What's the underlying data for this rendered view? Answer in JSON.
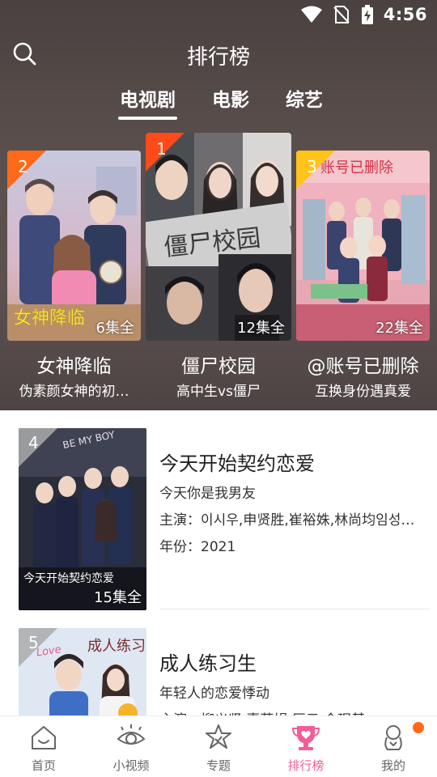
{
  "status": {
    "time": "4:56"
  },
  "header": {
    "title": "排行榜"
  },
  "tabs": [
    {
      "label": "电视剧",
      "active": true
    },
    {
      "label": "电影",
      "active": false
    },
    {
      "label": "综艺",
      "active": false
    }
  ],
  "podium": [
    {
      "rank": "2",
      "title": "女神降临",
      "subtitle": "伪素颜女神的初…",
      "episodes": "6集全",
      "poster_text": "女神降临",
      "rank_color": "#ff6a1a"
    },
    {
      "rank": "1",
      "title": "僵尸校园",
      "subtitle": "高中生vs僵尸",
      "episodes": "12集全",
      "poster_text": "僵尸校园",
      "rank_color": "#ff4a1a"
    },
    {
      "rank": "3",
      "title": "@账号已删除",
      "subtitle": "互换身份遇真爱",
      "episodes": "22集全",
      "poster_text": "账号已删除",
      "rank_color": "#ffc31a"
    }
  ],
  "list": [
    {
      "rank": "4",
      "title": "今天开始契约恋爱",
      "tagline": "今天你是我男友",
      "cast": "主演：이시우,申贤胜,崔裕姝,林尚均임성…",
      "year": "年份：2021",
      "episodes": "15集全",
      "poster_text": "今天开始契约恋爱",
      "poster_top": "BE MY BOY"
    },
    {
      "rank": "5",
      "title": "成人练习生",
      "tagline": "年轻人的恋爱悸动",
      "cast": "主演：柳义贤,惠荷娟,厉云,金珉基",
      "poster_text": "成人练习生",
      "poster_top": "Love"
    }
  ],
  "nav": [
    {
      "label": "首页",
      "icon": "home-icon",
      "active": false
    },
    {
      "label": "小视频",
      "icon": "eye-icon",
      "active": false
    },
    {
      "label": "专题",
      "icon": "star-badge-icon",
      "active": false
    },
    {
      "label": "排行榜",
      "icon": "trophy-heart-icon",
      "active": true
    },
    {
      "label": "我的",
      "icon": "profile-icon",
      "active": false,
      "badge": true
    }
  ],
  "colors": {
    "accent": "#f25f97",
    "badge": "#ff6a1a",
    "hero_bg": "#4f4644"
  }
}
